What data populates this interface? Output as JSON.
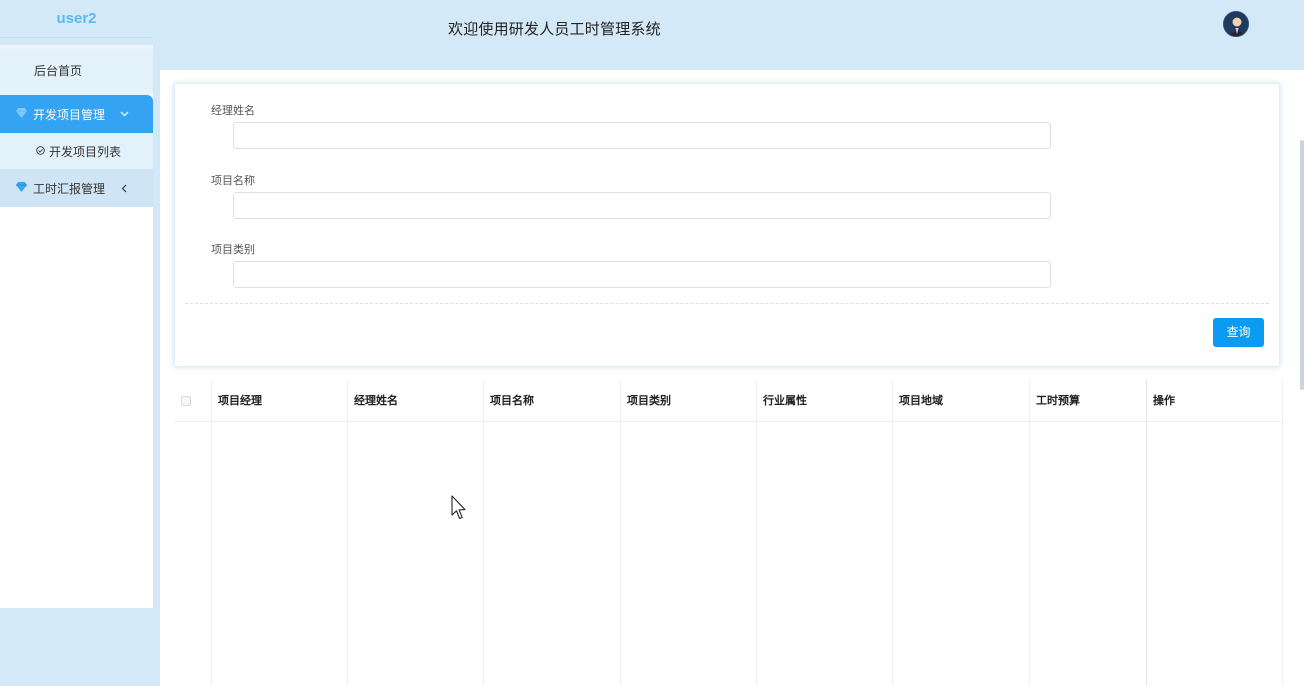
{
  "header": {
    "brand": "user2",
    "title": "欢迎使用研发人员工时管理系统",
    "avatar_icon": "user-avatar-icon"
  },
  "sidebar": {
    "home": "后台首页",
    "dev_project_mgmt": "开发项目管理",
    "dev_project_list": "开发项目列表",
    "work_report_mgmt": "工时汇报管理"
  },
  "search": {
    "manager_name_label": "经理姓名",
    "project_name_label": "项目名称",
    "project_type_label": "项目类别",
    "query_button": "查询"
  },
  "table": {
    "columns": [
      "项目经理",
      "经理姓名",
      "项目名称",
      "项目类别",
      "行业属性",
      "项目地域",
      "工时预算",
      "操作"
    ],
    "rows": []
  },
  "colors": {
    "accent": "#33a3f2",
    "button": "#0b9bf2",
    "background": "#d4e9f7",
    "brand": "#5cb8f0"
  }
}
